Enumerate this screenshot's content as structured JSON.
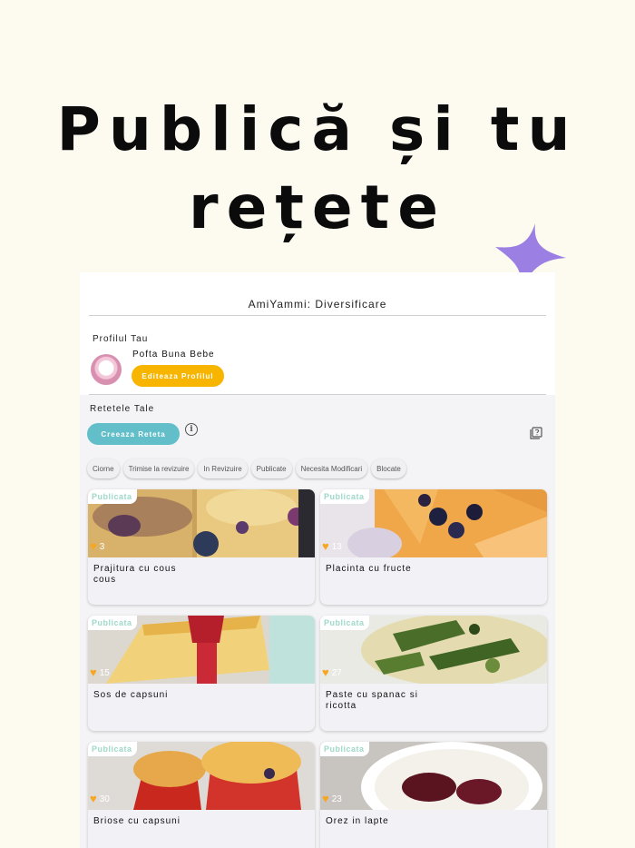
{
  "headline": {
    "line1": "Publică și tu",
    "line2": "rețete"
  },
  "app": {
    "title": "AmiYammi: Diversificare",
    "profile": {
      "heading": "Profilul Tau",
      "name": "Pofta Buna Bebe",
      "edit_label": "Editeaza Profilul"
    },
    "recipes": {
      "heading": "Retetele Tale",
      "create_label": "Creeaza Reteta",
      "info_glyph": "i",
      "filters": [
        "Ciorne",
        "Trimise la revizuire",
        "In Revizuire",
        "Publicate",
        "Necesita Modificari",
        "Blocate"
      ],
      "cards": [
        {
          "status": "Publicata",
          "likes": "3",
          "title": "Prajitura cu cous cous"
        },
        {
          "status": "Publicata",
          "likes": "13",
          "title": "Placinta cu fructe"
        },
        {
          "status": "Publicata",
          "likes": "15",
          "title": "Sos de capsuni"
        },
        {
          "status": "Publicata",
          "likes": "27",
          "title": "Paste cu spanac si ricotta"
        },
        {
          "status": "Publicata",
          "likes": "30",
          "title": "Briose cu capsuni"
        },
        {
          "status": "Publicata",
          "likes": "23",
          "title": "Orez in lapte"
        }
      ]
    }
  },
  "colors": {
    "background": "#fdfaf0",
    "sparkle": "#9b7fe3",
    "edit_button": "#f7b500",
    "create_button": "#62bec8",
    "heart": "#f5a623",
    "status_badge_text": "#9fd9c8"
  },
  "icons": [
    "sparkle-icon",
    "info-icon",
    "help-book-icon",
    "heart-icon"
  ]
}
